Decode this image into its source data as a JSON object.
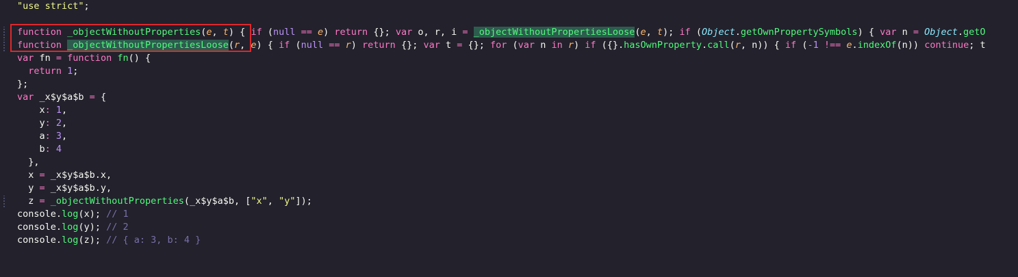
{
  "editor": {
    "lines": [
      {
        "gutter": false,
        "tokens": [
          {
            "t": "\"use strict\"",
            "c": "str"
          },
          {
            "t": ";",
            "c": "plain"
          }
        ]
      },
      {
        "gutter": false,
        "tokens": []
      },
      {
        "gutter": true,
        "tokens": [
          {
            "t": "function ",
            "c": "kw"
          },
          {
            "t": "_objectWithoutProperties",
            "c": "fn"
          },
          {
            "t": "(",
            "c": "plain"
          },
          {
            "t": "e",
            "c": "param"
          },
          {
            "t": ", ",
            "c": "plain"
          },
          {
            "t": "t",
            "c": "param"
          },
          {
            "t": ") { ",
            "c": "plain"
          },
          {
            "t": "if ",
            "c": "kw"
          },
          {
            "t": "(",
            "c": "plain"
          },
          {
            "t": "null",
            "c": "num"
          },
          {
            "t": " == ",
            "c": "op"
          },
          {
            "t": "e",
            "c": "param"
          },
          {
            "t": ") ",
            "c": "plain"
          },
          {
            "t": "return ",
            "c": "kw"
          },
          {
            "t": "{}; ",
            "c": "plain"
          },
          {
            "t": "var ",
            "c": "kw"
          },
          {
            "t": "o, r, i ",
            "c": "plain"
          },
          {
            "t": "= ",
            "c": "op"
          },
          {
            "t": "_objectWithoutPropertiesLoose",
            "c": "fn hl"
          },
          {
            "t": "(",
            "c": "plain"
          },
          {
            "t": "e",
            "c": "param"
          },
          {
            "t": ", ",
            "c": "plain"
          },
          {
            "t": "t",
            "c": "param"
          },
          {
            "t": "); ",
            "c": "plain"
          },
          {
            "t": "if ",
            "c": "kw"
          },
          {
            "t": "(",
            "c": "plain"
          },
          {
            "t": "Object",
            "c": "class"
          },
          {
            "t": ".",
            "c": "plain"
          },
          {
            "t": "getOwnPropertySymbols",
            "c": "fn"
          },
          {
            "t": ") { ",
            "c": "plain"
          },
          {
            "t": "var ",
            "c": "kw"
          },
          {
            "t": "n ",
            "c": "plain"
          },
          {
            "t": "= ",
            "c": "op"
          },
          {
            "t": "Object",
            "c": "class"
          },
          {
            "t": ".",
            "c": "plain"
          },
          {
            "t": "getO",
            "c": "fn"
          }
        ]
      },
      {
        "gutter": true,
        "tokens": [
          {
            "t": "function ",
            "c": "kw"
          },
          {
            "t": "_objectWithoutPropertiesLoose",
            "c": "fn hl"
          },
          {
            "t": "(",
            "c": "plain"
          },
          {
            "t": "r",
            "c": "param"
          },
          {
            "t": ", ",
            "c": "plain"
          },
          {
            "t": "e",
            "c": "param"
          },
          {
            "t": ") { ",
            "c": "plain"
          },
          {
            "t": "if ",
            "c": "kw"
          },
          {
            "t": "(",
            "c": "plain"
          },
          {
            "t": "null",
            "c": "num"
          },
          {
            "t": " == ",
            "c": "op"
          },
          {
            "t": "r",
            "c": "param"
          },
          {
            "t": ") ",
            "c": "plain"
          },
          {
            "t": "return ",
            "c": "kw"
          },
          {
            "t": "{}; ",
            "c": "plain"
          },
          {
            "t": "var ",
            "c": "kw"
          },
          {
            "t": "t ",
            "c": "plain"
          },
          {
            "t": "= ",
            "c": "op"
          },
          {
            "t": "{}; ",
            "c": "plain"
          },
          {
            "t": "for ",
            "c": "kw"
          },
          {
            "t": "(",
            "c": "plain"
          },
          {
            "t": "var ",
            "c": "kw"
          },
          {
            "t": "n ",
            "c": "plain"
          },
          {
            "t": "in ",
            "c": "kw"
          },
          {
            "t": "r",
            "c": "param"
          },
          {
            "t": ") ",
            "c": "plain"
          },
          {
            "t": "if ",
            "c": "kw"
          },
          {
            "t": "({}.",
            "c": "plain"
          },
          {
            "t": "hasOwnProperty",
            "c": "fn"
          },
          {
            "t": ".",
            "c": "plain"
          },
          {
            "t": "call",
            "c": "fn"
          },
          {
            "t": "(",
            "c": "plain"
          },
          {
            "t": "r",
            "c": "param"
          },
          {
            "t": ", n)) { ",
            "c": "plain"
          },
          {
            "t": "if ",
            "c": "kw"
          },
          {
            "t": "(",
            "c": "plain"
          },
          {
            "t": "-1",
            "c": "num"
          },
          {
            "t": " !== ",
            "c": "op"
          },
          {
            "t": "e",
            "c": "param"
          },
          {
            "t": ".",
            "c": "plain"
          },
          {
            "t": "indexOf",
            "c": "fn"
          },
          {
            "t": "(n)) ",
            "c": "plain"
          },
          {
            "t": "continue",
            "c": "kw"
          },
          {
            "t": "; t",
            "c": "plain"
          }
        ]
      },
      {
        "gutter": false,
        "tokens": [
          {
            "t": "var ",
            "c": "kw"
          },
          {
            "t": "fn ",
            "c": "plain"
          },
          {
            "t": "= ",
            "c": "op"
          },
          {
            "t": "function ",
            "c": "kw"
          },
          {
            "t": "fn",
            "c": "fn"
          },
          {
            "t": "() {",
            "c": "plain"
          }
        ]
      },
      {
        "gutter": false,
        "tokens": [
          {
            "t": "  return ",
            "c": "kw"
          },
          {
            "t": "1",
            "c": "num"
          },
          {
            "t": ";",
            "c": "plain"
          }
        ]
      },
      {
        "gutter": false,
        "tokens": [
          {
            "t": "};",
            "c": "plain"
          }
        ]
      },
      {
        "gutter": false,
        "tokens": [
          {
            "t": "var ",
            "c": "kw"
          },
          {
            "t": "_x$y$a$b ",
            "c": "plain"
          },
          {
            "t": "= ",
            "c": "op"
          },
          {
            "t": "{",
            "c": "plain"
          }
        ]
      },
      {
        "gutter": false,
        "tokens": [
          {
            "t": "    x",
            "c": "plain"
          },
          {
            "t": ": ",
            "c": "op"
          },
          {
            "t": "1",
            "c": "num"
          },
          {
            "t": ",",
            "c": "plain"
          }
        ]
      },
      {
        "gutter": false,
        "tokens": [
          {
            "t": "    y",
            "c": "plain"
          },
          {
            "t": ": ",
            "c": "op"
          },
          {
            "t": "2",
            "c": "num"
          },
          {
            "t": ",",
            "c": "plain"
          }
        ]
      },
      {
        "gutter": false,
        "tokens": [
          {
            "t": "    a",
            "c": "plain"
          },
          {
            "t": ": ",
            "c": "op"
          },
          {
            "t": "3",
            "c": "num"
          },
          {
            "t": ",",
            "c": "plain"
          }
        ]
      },
      {
        "gutter": false,
        "tokens": [
          {
            "t": "    b",
            "c": "plain"
          },
          {
            "t": ": ",
            "c": "op"
          },
          {
            "t": "4",
            "c": "num"
          }
        ]
      },
      {
        "gutter": false,
        "tokens": [
          {
            "t": "  },",
            "c": "plain"
          }
        ]
      },
      {
        "gutter": false,
        "tokens": [
          {
            "t": "  x ",
            "c": "plain"
          },
          {
            "t": "= ",
            "c": "op"
          },
          {
            "t": "_x$y$a$b.x,",
            "c": "plain"
          }
        ]
      },
      {
        "gutter": false,
        "tokens": [
          {
            "t": "  y ",
            "c": "plain"
          },
          {
            "t": "= ",
            "c": "op"
          },
          {
            "t": "_x$y$a$b.y,",
            "c": "plain"
          }
        ]
      },
      {
        "gutter": true,
        "tokens": [
          {
            "t": "  z ",
            "c": "plain"
          },
          {
            "t": "= ",
            "c": "op"
          },
          {
            "t": "_objectWithoutProperties",
            "c": "fn"
          },
          {
            "t": "(_x$y$a$b, [",
            "c": "plain"
          },
          {
            "t": "\"x\"",
            "c": "str"
          },
          {
            "t": ", ",
            "c": "plain"
          },
          {
            "t": "\"y\"",
            "c": "str"
          },
          {
            "t": "]);",
            "c": "plain"
          }
        ]
      },
      {
        "gutter": false,
        "tokens": [
          {
            "t": "console",
            "c": "plain"
          },
          {
            "t": ".",
            "c": "plain"
          },
          {
            "t": "log",
            "c": "fn"
          },
          {
            "t": "(x); ",
            "c": "plain"
          },
          {
            "t": "// 1",
            "c": "comment"
          }
        ]
      },
      {
        "gutter": false,
        "tokens": [
          {
            "t": "console",
            "c": "plain"
          },
          {
            "t": ".",
            "c": "plain"
          },
          {
            "t": "log",
            "c": "fn"
          },
          {
            "t": "(y); ",
            "c": "plain"
          },
          {
            "t": "// 2",
            "c": "comment"
          }
        ]
      },
      {
        "gutter": false,
        "tokens": [
          {
            "t": "console",
            "c": "plain"
          },
          {
            "t": ".",
            "c": "plain"
          },
          {
            "t": "log",
            "c": "fn"
          },
          {
            "t": "(z); ",
            "c": "plain"
          },
          {
            "t": "// { a: 3, b: 4 }",
            "c": "comment"
          }
        ]
      }
    ]
  },
  "colors": {
    "background": "#22212c",
    "highlight_box": "#e0272b"
  }
}
